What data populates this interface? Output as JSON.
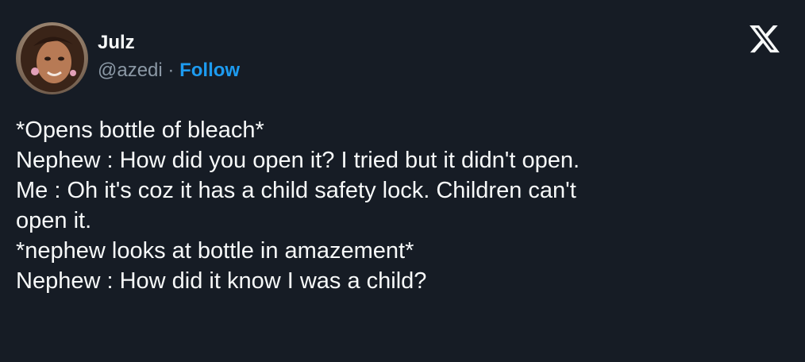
{
  "tweet": {
    "author": {
      "display_name": "Julz",
      "handle": "@azedi",
      "separator": " · ",
      "follow_label": "Follow"
    },
    "lines": [
      "*Opens bottle of bleach*",
      "Nephew : How did you open it? I tried but it didn't open.",
      "Me : Oh it's coz it has a child safety lock. Children can't",
      "open it.",
      "*nephew looks at bottle in amazement*",
      "Nephew : How did it know I was a child?"
    ]
  },
  "colors": {
    "background": "#161c25",
    "text": "#f7f9f9",
    "secondary_text": "#8b98a5",
    "link": "#1d9bf0"
  },
  "icons": {
    "brand": "x-logo-icon",
    "avatar": "profile-photo"
  }
}
